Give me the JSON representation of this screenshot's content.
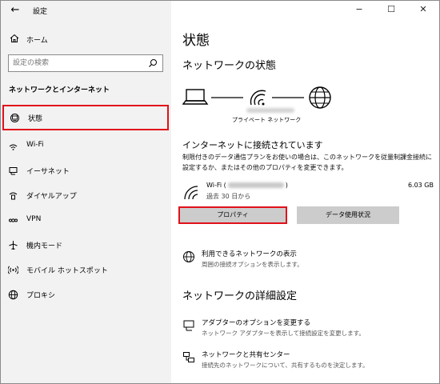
{
  "window": {
    "app_title": "設定",
    "controls": {
      "minimize": "−",
      "maximize": "☐",
      "close": "✕"
    }
  },
  "sidebar": {
    "back_glyph": "←",
    "home_label": "ホーム",
    "search_placeholder": "設定の検索",
    "section_title": "ネットワークとインターネット",
    "items": [
      {
        "label": "状態",
        "icon": "status-icon",
        "active": true
      },
      {
        "label": "Wi-Fi",
        "icon": "wifi-icon"
      },
      {
        "label": "イーサネット",
        "icon": "ethernet-icon"
      },
      {
        "label": "ダイヤルアップ",
        "icon": "dialup-icon"
      },
      {
        "label": "VPN",
        "icon": "vpn-icon"
      },
      {
        "label": "機内モード",
        "icon": "airplane-icon"
      },
      {
        "label": "モバイル ホットスポット",
        "icon": "hotspot-icon"
      },
      {
        "label": "プロキシ",
        "icon": "proxy-icon"
      }
    ]
  },
  "main": {
    "page_title": "状態",
    "network_status_heading": "ネットワークの状態",
    "diagram": {
      "network_type": "プライベート ネットワーク"
    },
    "connected_title": "インターネットに接続されています",
    "connected_desc": "制限付きのデータ通信プランをお使いの場合は、このネットワークを従量制課金接続に設定するか、またはその他のプロパティを変更できます。",
    "wifi": {
      "name_prefix": "Wi-Fi (",
      "name_suffix": ")",
      "since": "過去 30 日から",
      "usage": "6.03 GB"
    },
    "buttons": {
      "properties": "プロパティ",
      "data_usage": "データ使用状況"
    },
    "available_networks": {
      "title": "利用できるネットワークの表示",
      "sub": "周囲の接続オプションを表示します。"
    },
    "advanced_heading": "ネットワークの詳細設定",
    "adapter_options": {
      "title": "アダプターのオプションを変更する",
      "sub": "ネットワーク アダプターを表示して接続設定を変更します。"
    },
    "sharing_center": {
      "title": "ネットワークと共有センター",
      "sub": "接続先のネットワークについて、共有するものを決定します。"
    }
  }
}
